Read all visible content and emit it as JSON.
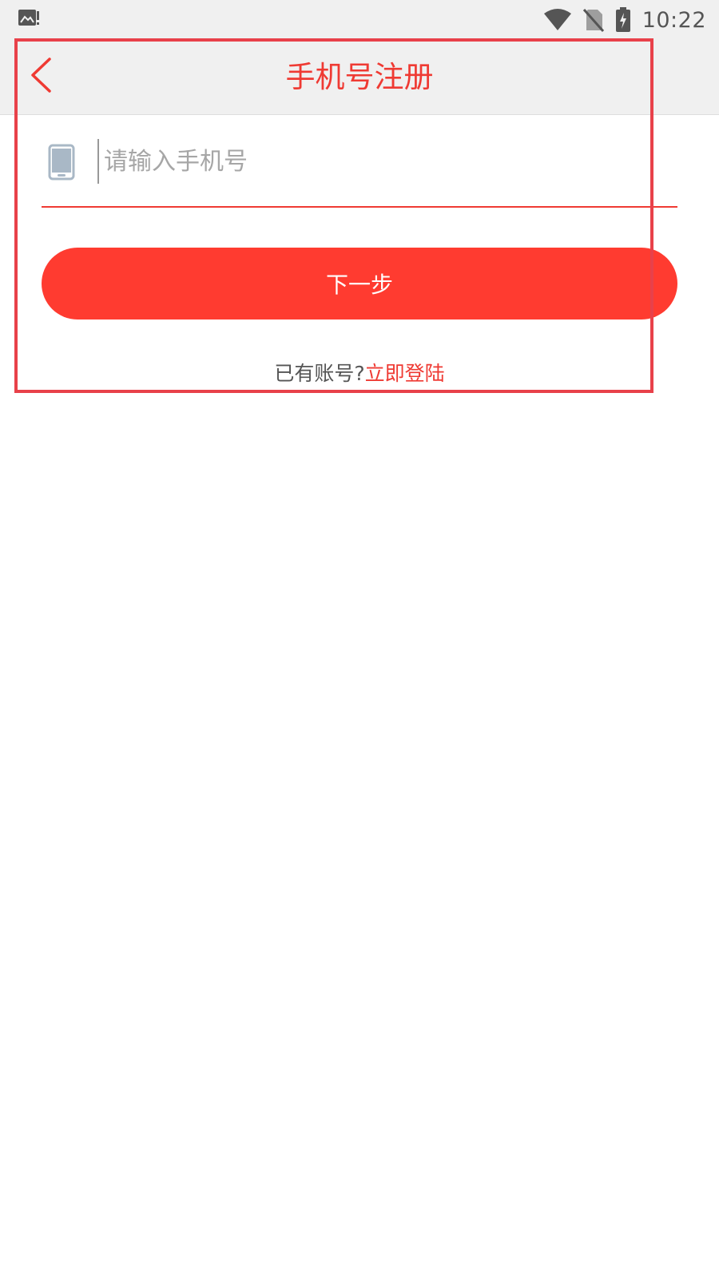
{
  "status_bar": {
    "time": "10:22",
    "left_icon": "image-alert-icon",
    "icons": [
      "wifi-icon",
      "no-sim-icon",
      "battery-charging-icon"
    ]
  },
  "header": {
    "title": "手机号注册",
    "back_icon": "chevron-left-icon"
  },
  "form": {
    "phone_icon": "smartphone-icon",
    "phone_input": {
      "value": "",
      "placeholder": "请输入手机号"
    },
    "next_label": "下一步"
  },
  "footer": {
    "prompt": "已有账号?",
    "login_link": "立即登陆"
  },
  "colors": {
    "accent": "#ef3a33",
    "button": "#ff3b30",
    "bar_background": "#f0f0f0",
    "highlight_border": "#e8414a"
  }
}
